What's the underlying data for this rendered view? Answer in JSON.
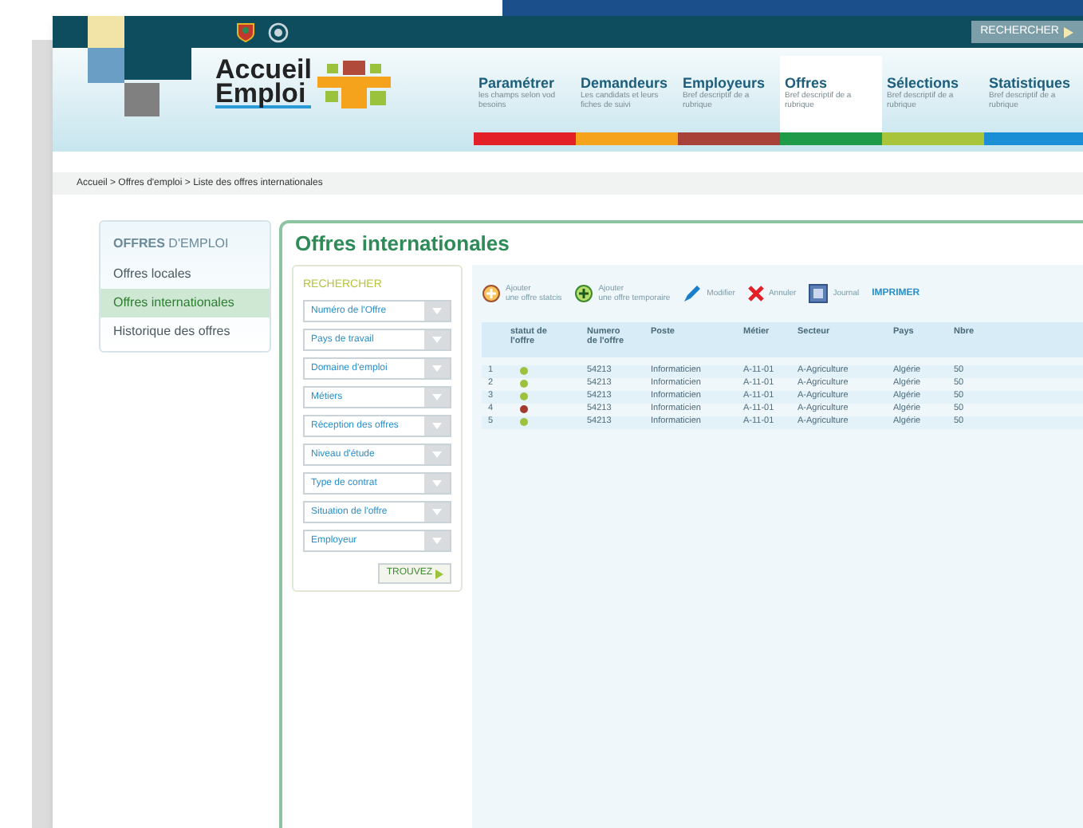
{
  "top_bar": {
    "search_button": "RECHERCHER"
  },
  "logo": {
    "line1": "Accueil",
    "line2": "Emploi"
  },
  "nav": [
    {
      "title": "Paramétrer",
      "subtitle": "les champs selon vod besoins",
      "color": "#e32027",
      "selected": false
    },
    {
      "title": "Demandeurs",
      "subtitle": "Les candidats et leurs fiches de suivi",
      "color": "#f5a21c",
      "selected": false
    },
    {
      "title": "Employeurs",
      "subtitle": "Bref descriptif de a rubrique",
      "color": "#a84238",
      "selected": false
    },
    {
      "title": "Offres",
      "subtitle": "Bref descriptif de a rubrique",
      "color": "#1f9a48",
      "selected": true
    },
    {
      "title": "Sélections",
      "subtitle": "Bref descriptif de a rubrique",
      "color": "#a8c43a",
      "selected": false
    },
    {
      "title": "Statistiques",
      "subtitle": "Bref descriptif de a rubrique",
      "color": "#1a8fd6",
      "selected": false
    }
  ],
  "breadcrumb": "Accueil > Offres d'emploi > Liste des offres internationales",
  "sidebar": {
    "heading": "**OFFRES** D'EMPLOI",
    "items": [
      {
        "label": "Offres locales",
        "selected": false
      },
      {
        "label": "Offres internationales",
        "selected": true
      },
      {
        "label": "Historique des offres",
        "selected": false
      }
    ]
  },
  "main": {
    "title": "Offres internationales",
    "search": {
      "heading": "RECHERCHER",
      "filters": [
        "Numéro de l'Offre",
        "Pays de travail",
        "Domaine d'emploi",
        "Métiers",
        "Réception des offres",
        "Niveau d'étude",
        "Type de contrat",
        "Situation de l'offre",
        "Employeur"
      ],
      "button": "TROUVEZ"
    },
    "toolbar": [
      {
        "kind": "add_static",
        "lines": [
          "Ajouter",
          "une offre statcis"
        ]
      },
      {
        "kind": "add_temporary",
        "lines": [
          "Ajouter",
          "une offre temporaire"
        ]
      },
      {
        "kind": "edit",
        "lines": [
          "Modifier"
        ]
      },
      {
        "kind": "cancel",
        "lines": [
          "Annuler"
        ]
      },
      {
        "kind": "journal",
        "lines": [
          "Journal"
        ]
      },
      {
        "kind": "print",
        "lines": [
          "IMPRIMER"
        ]
      }
    ],
    "table": {
      "status_column": "statut de l'offre",
      "columns": [
        "Numero de l'offre",
        "Poste",
        "Métier",
        "Secteur",
        "Pays",
        "Nbre"
      ],
      "rows": [
        {
          "index": "1",
          "color": "#9bc23c",
          "cells": [
            "54213",
            "Informaticien",
            "A-11-01",
            "A-Agriculture",
            "Algérie",
            "50"
          ]
        },
        {
          "index": "2",
          "color": "#9bc23c",
          "cells": [
            "54213",
            "Informaticien",
            "A-11-01",
            "A-Agriculture",
            "Algérie",
            "50"
          ]
        },
        {
          "index": "3",
          "color": "#9bc23c",
          "cells": [
            "54213",
            "Informaticien",
            "A-11-01",
            "A-Agriculture",
            "Algérie",
            "50"
          ]
        },
        {
          "index": "4",
          "color": "#a33a2e",
          "cells": [
            "54213",
            "Informaticien",
            "A-11-01",
            "A-Agriculture",
            "Algérie",
            "50"
          ]
        },
        {
          "index": "5",
          "color": "#9bc23c",
          "cells": [
            "54213",
            "Informaticien",
            "A-11-01",
            "A-Agriculture",
            "Algérie",
            "50"
          ]
        }
      ]
    }
  }
}
